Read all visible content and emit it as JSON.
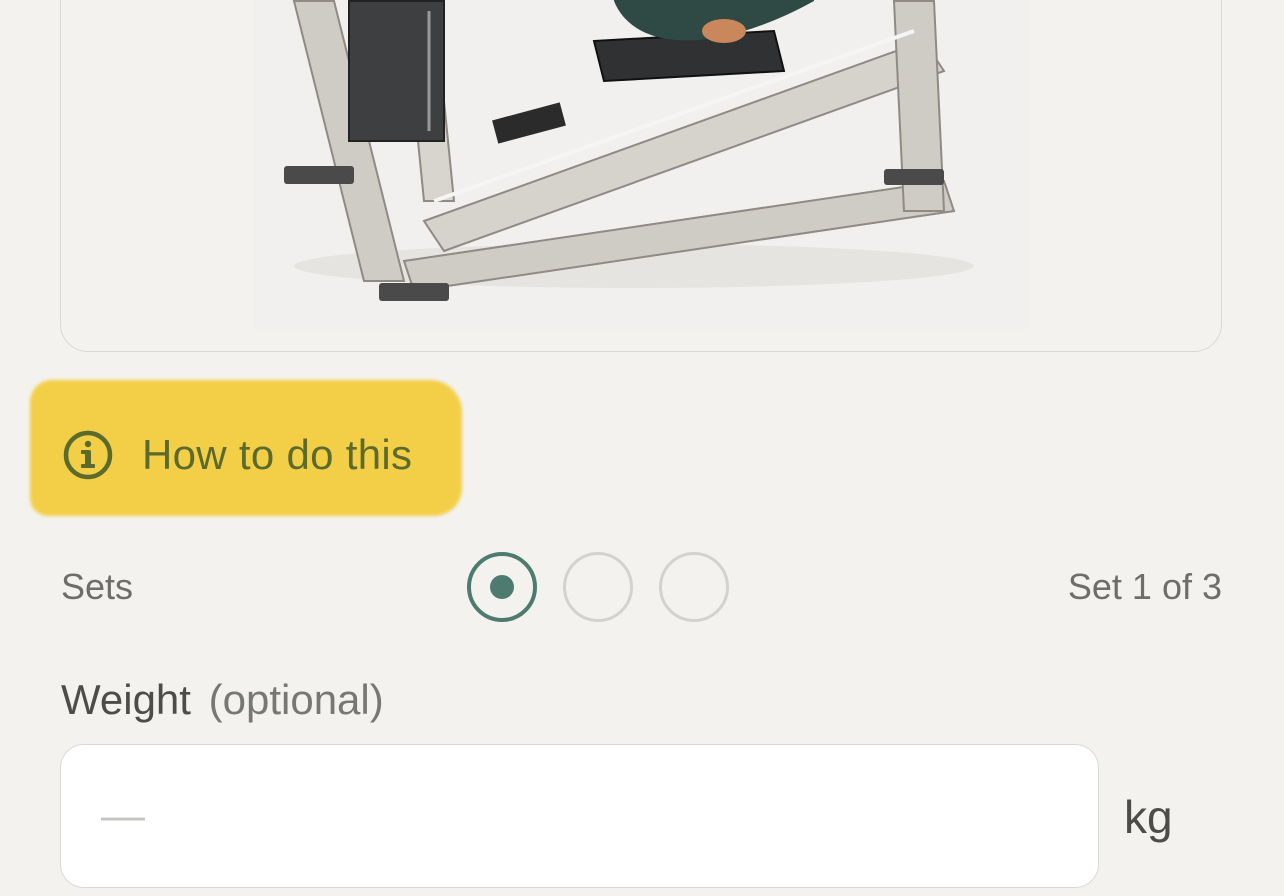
{
  "how_to": {
    "label": "How to do this",
    "icon": "info-icon",
    "highlight_color": "#f3cf48",
    "text_color": "#5c6a2c"
  },
  "sets": {
    "label": "Sets",
    "total": 3,
    "current": 1,
    "progress_text": "Set 1 of 3",
    "active_color": "#4d7b6f"
  },
  "weight": {
    "label": "Weight",
    "optional_label": "(optional)",
    "value": "",
    "placeholder": "—",
    "unit": "kg"
  }
}
